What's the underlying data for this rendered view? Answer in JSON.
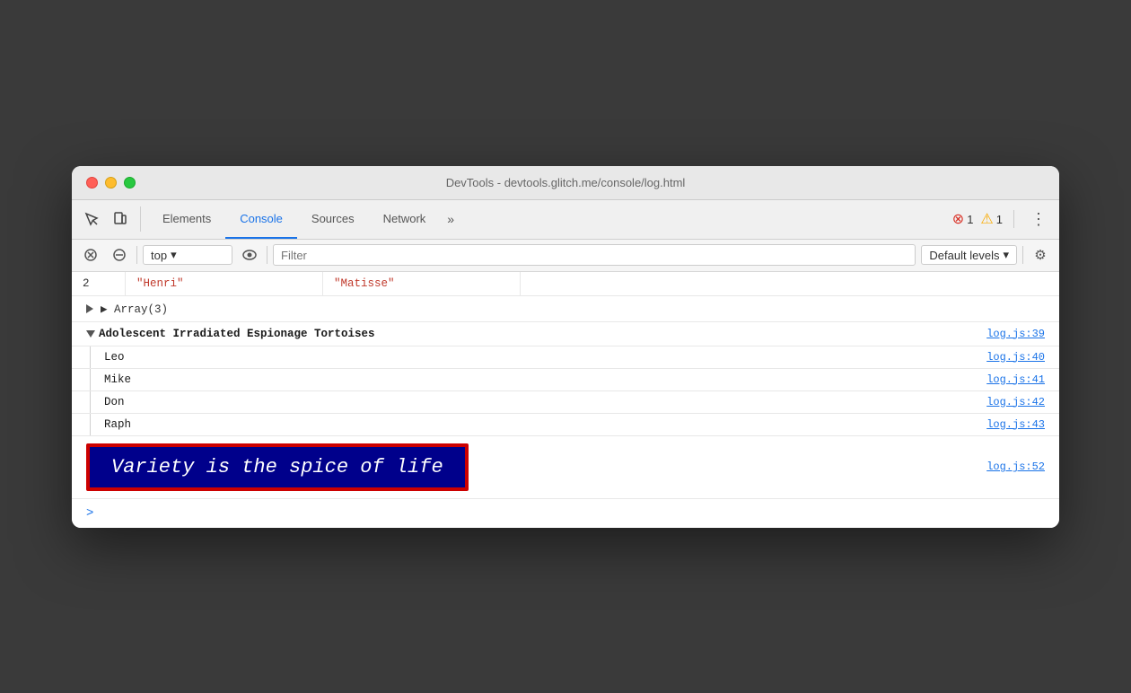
{
  "window": {
    "title": "DevTools - devtools.glitch.me/console/log.html"
  },
  "toolbar": {
    "tabs": [
      {
        "id": "elements",
        "label": "Elements",
        "active": false
      },
      {
        "id": "console",
        "label": "Console",
        "active": true
      },
      {
        "id": "sources",
        "label": "Sources",
        "active": false
      },
      {
        "id": "network",
        "label": "Network",
        "active": false
      }
    ],
    "more_label": "»",
    "error_count": "1",
    "warn_count": "1",
    "three_dots": "⋮"
  },
  "console_toolbar": {
    "context_label": "top",
    "filter_placeholder": "Filter",
    "levels_label": "Default levels",
    "dropdown_arrow": "▾"
  },
  "console": {
    "table_row": {
      "index": "2",
      "first_name": "\"Henri\"",
      "last_name": "\"Matisse\""
    },
    "array_label": "▶ Array(3)",
    "group": {
      "label": "Adolescent Irradiated Espionage Tortoises",
      "line_ref": "log.js:39"
    },
    "list_items": [
      {
        "name": "Leo",
        "line_ref": "log.js:40"
      },
      {
        "name": "Mike",
        "line_ref": "log.js:41"
      },
      {
        "name": "Don",
        "line_ref": "log.js:42"
      },
      {
        "name": "Raph",
        "line_ref": "log.js:43"
      }
    ],
    "styled_output": {
      "text": "Variety is the spice of life",
      "line_ref": "log.js:52"
    },
    "prompt_chevron": ">"
  }
}
